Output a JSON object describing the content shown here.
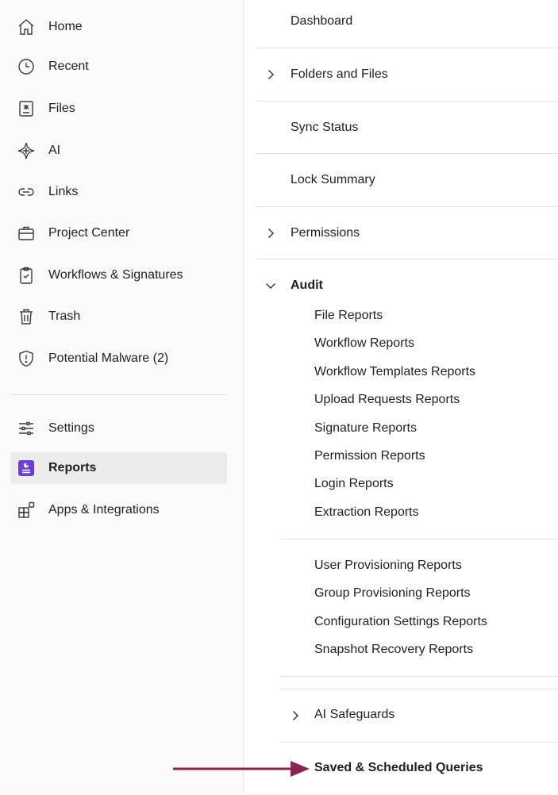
{
  "sidebar": {
    "items": [
      {
        "label": "Home",
        "icon": "home-icon"
      },
      {
        "label": "Recent",
        "icon": "clock-icon"
      },
      {
        "label": "Files",
        "icon": "file-icon"
      },
      {
        "label": "AI",
        "icon": "sparkle-icon"
      },
      {
        "label": "Links",
        "icon": "link-icon"
      },
      {
        "label": "Project Center",
        "icon": "briefcase-icon"
      },
      {
        "label": "Workflows & Signatures",
        "icon": "clipboard-check-icon"
      },
      {
        "label": "Trash",
        "icon": "trash-icon"
      },
      {
        "label": "Potential Malware (2)",
        "icon": "shield-alert-icon"
      }
    ],
    "bottom_items": [
      {
        "label": "Settings",
        "icon": "sliders-icon"
      },
      {
        "label": "Reports",
        "icon": "reports-icon",
        "active": true
      },
      {
        "label": "Apps & Integrations",
        "icon": "apps-icon"
      }
    ],
    "accent_color": "#6b3fd4"
  },
  "main": {
    "rows": [
      {
        "label": "Dashboard"
      },
      {
        "label": "Folders and Files",
        "collapsed": true
      },
      {
        "label": "Sync Status"
      },
      {
        "label": "Lock Summary"
      },
      {
        "label": "Permissions",
        "collapsed": true
      },
      {
        "label": "Audit",
        "expanded": true
      }
    ],
    "audit_group_1": [
      "File Reports",
      "Workflow Reports",
      "Workflow Templates Reports",
      "Upload Requests Reports",
      "Signature Reports",
      "Permission Reports",
      "Login Reports",
      "Extraction Reports"
    ],
    "audit_group_2": [
      "User Provisioning Reports",
      "Group Provisioning Reports",
      "Configuration Settings Reports",
      "Snapshot Recovery Reports"
    ],
    "ai_safeguards": {
      "label": "AI Safeguards",
      "collapsed": true
    },
    "saved_queries": {
      "label": "Saved & Scheduled Queries"
    }
  },
  "annotation": {
    "arrow_color": "#8b2252",
    "target": "saved-scheduled-queries"
  }
}
